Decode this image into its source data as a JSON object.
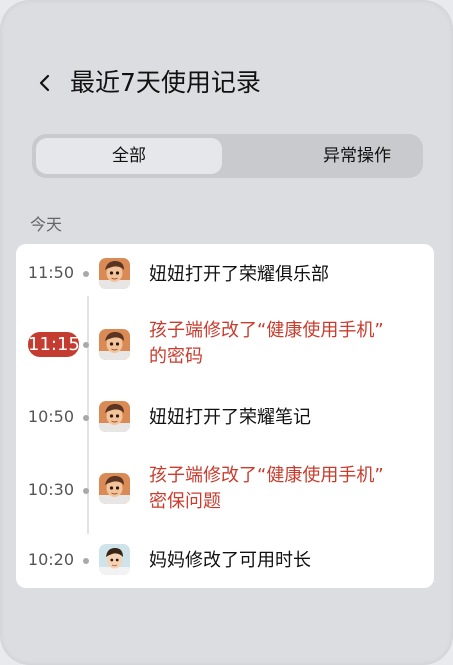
{
  "header": {
    "title": "最近7天使用记录"
  },
  "segment": {
    "all": "全部",
    "abnormal": "异常操作"
  },
  "section": {
    "today": "今天"
  },
  "entries": [
    {
      "time": "11:50",
      "line1": "妞妞打开了荣耀俱乐部",
      "line2": ""
    },
    {
      "time": "11:15",
      "line1": "孩子端修改了“健康使用手机”",
      "line2": "的密码"
    },
    {
      "time": "10:50",
      "line1": "妞妞打开了荣耀笔记",
      "line2": ""
    },
    {
      "time": "10:30",
      "line1": "孩子端修改了“健康使用手机”",
      "line2": "密保问题"
    },
    {
      "time": "10:20",
      "line1": "妈妈修改了可用时长",
      "line2": ""
    }
  ],
  "colors": {
    "alert": "#c93c2e",
    "badge": "#c43c2f"
  }
}
